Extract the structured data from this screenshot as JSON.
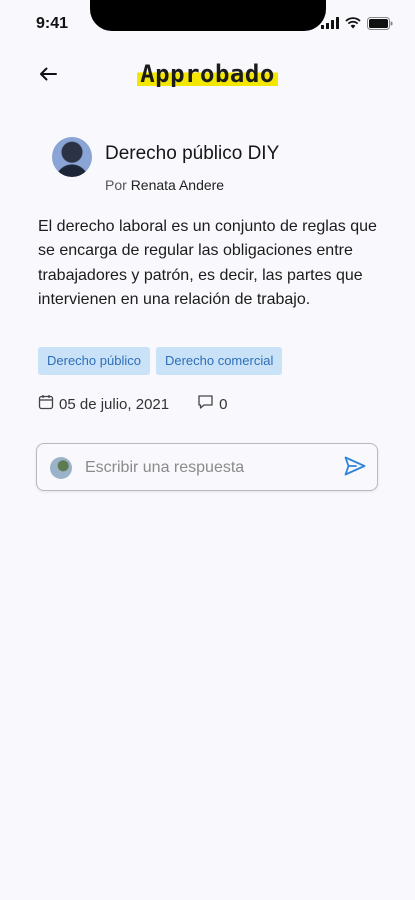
{
  "status_bar": {
    "time": "9:41"
  },
  "header": {
    "brand": "Approbado",
    "back_icon": "arrow-left-icon"
  },
  "post": {
    "title": "Derecho público DIY",
    "author_prefix": "Por",
    "author_name": "Renata Andere",
    "body": "El derecho laboral es un conjunto de reglas que se encarga de regular las obligaciones entre trabajadores y patrón, es decir, las partes que intervienen en una relación de trabajo.",
    "tags": [
      {
        "label": "Derecho público"
      },
      {
        "label": "Derecho comercial"
      }
    ],
    "date": "05 de julio, 2021",
    "comments": "0"
  },
  "reply": {
    "placeholder": "Escribir una respuesta",
    "value": "",
    "send_icon": "send-icon"
  },
  "colors": {
    "background": "#f8f8fd",
    "brand_highlight": "#f3e600",
    "tag_bg": "#c9e2f7",
    "tag_text": "#2e6fba",
    "send_icon": "#2f84d8"
  }
}
